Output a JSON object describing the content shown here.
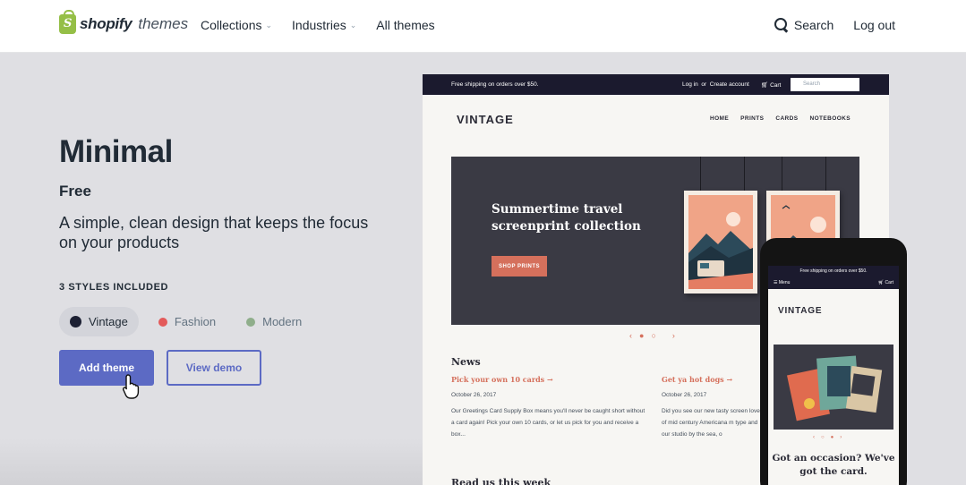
{
  "nav": {
    "brand": "shopify",
    "brand_sub": "themes",
    "links": [
      {
        "label": "Collections"
      },
      {
        "label": "Industries"
      },
      {
        "label": "All themes"
      }
    ],
    "search_label": "Search",
    "logout_label": "Log out"
  },
  "theme": {
    "name": "Minimal",
    "price": "Free",
    "tagline": "A simple, clean design that keeps the focus on your products",
    "styles_label": "3 STYLES INCLUDED",
    "styles": [
      {
        "label": "Vintage",
        "color": "#1c2033",
        "active": true
      },
      {
        "label": "Fashion",
        "color": "#e35a5a",
        "active": false
      },
      {
        "label": "Modern",
        "color": "#8fae8b",
        "active": false
      }
    ],
    "add_label": "Add theme",
    "demo_label": "View demo"
  },
  "preview": {
    "announcement": "Free shipping on orders over $50.",
    "login": "Log in",
    "or": "or",
    "create": "Create account",
    "cart": "Cart",
    "search_placeholder": "Search",
    "logo": "VINTAGE",
    "menu": [
      "HOME",
      "PRINTS",
      "CARDS",
      "NOTEBOOKS"
    ],
    "hero_title": "Summertime travel screenprint collection",
    "hero_button": "SHOP PRINTS",
    "news_heading": "News",
    "articles": [
      {
        "title": "Pick your own 10 cards →",
        "date": "October 26, 2017",
        "body": "Our Greetings Card Supply Box means you'll never be caught short without a card again! Pick your own 10 cards, or let us pick for you and receive a box..."
      },
      {
        "title": "Get ya hot dogs →",
        "date": "October 26, 2017",
        "body": "Did you see our new tasty screen love of mid century Americana m type and our studio by the sea, o"
      }
    ],
    "next_heading": "Read us this week"
  },
  "phone": {
    "announcement": "Free shipping on orders over $50.",
    "menu": "Menu",
    "cart": "Cart",
    "logo": "VINTAGE",
    "caption": "Got an occasion? We've got the card."
  },
  "colors": {
    "accent": "#5c6ac4",
    "brand_green": "#95bf47",
    "coral": "#d5705c"
  }
}
